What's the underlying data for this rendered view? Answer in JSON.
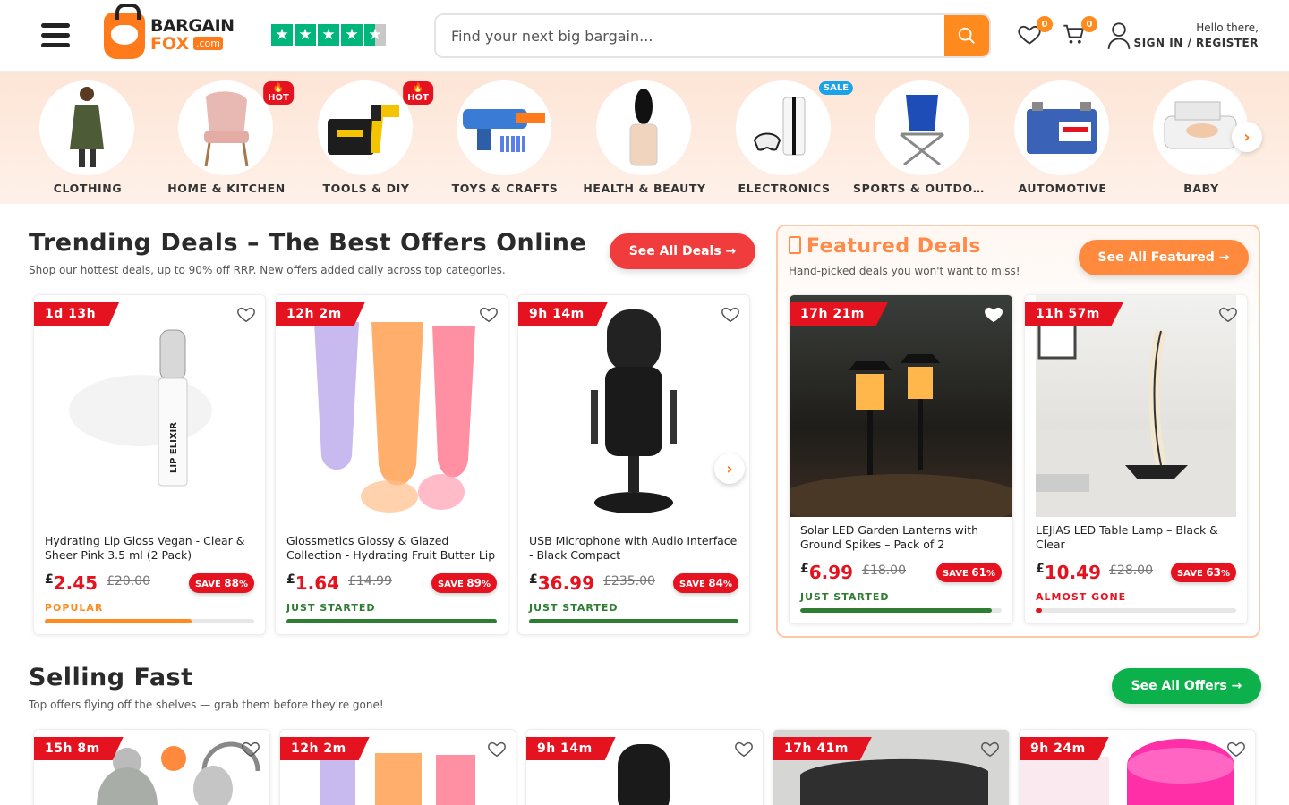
{
  "header": {
    "logo_line1": "BARGAIN",
    "logo_line2": "FOX",
    "logo_suffix": ".com",
    "search_placeholder": "Find your next big bargain...",
    "wishlist_count": "0",
    "cart_count": "0",
    "hello": "Hello there,",
    "sign_in": "SIGN IN / REGISTER"
  },
  "categories": [
    {
      "label": "CLOTHING",
      "tag": ""
    },
    {
      "label": "HOME & KITCHEN",
      "tag": "🔥HOT"
    },
    {
      "label": "TOOLS & DIY",
      "tag": "🔥HOT"
    },
    {
      "label": "TOYS & CRAFTS",
      "tag": ""
    },
    {
      "label": "HEALTH & BEAUTY",
      "tag": ""
    },
    {
      "label": "ELECTRONICS",
      "tag": "SALE"
    },
    {
      "label": "SPORTS & OUTDOORS",
      "tag": ""
    },
    {
      "label": "AUTOMOTIVE",
      "tag": ""
    },
    {
      "label": "BABY",
      "tag": ""
    }
  ],
  "trending": {
    "title": "Trending Deals – The Best Offers Online",
    "subtitle": "Shop our hottest deals, up to 90% off RRP. New offers added daily across top categories.",
    "button": "See All Deals →",
    "products": [
      {
        "timer": "1d 13h",
        "title": "Hydrating Lip Gloss Vegan - Clear & Sheer Pink 3.5 ml (2 Pack)",
        "currency": "£",
        "price": "2.45",
        "was": "£20.00",
        "save_label": "SAVE",
        "save": "88",
        "pct": "%",
        "status": "POPULAR",
        "progress": 0.7
      },
      {
        "timer": "12h 2m",
        "title": "Glossmetics Glossy & Glazed Collection - Hydrating Fruit Butter Lip Gloss",
        "currency": "£",
        "price": "1.64",
        "was": "£14.99",
        "save_label": "SAVE",
        "save": "89",
        "pct": "%",
        "status": "JUST STARTED",
        "progress": 1.0
      },
      {
        "timer": "9h 14m",
        "title": "USB Microphone with Audio Interface - Black Compact",
        "currency": "£",
        "price": "36.99",
        "was": "£235.00",
        "save_label": "SAVE",
        "save": "84",
        "pct": "%",
        "status": "JUST STARTED",
        "progress": 1.0
      }
    ]
  },
  "featured": {
    "title": "Featured Deals",
    "subtitle": "Hand-picked deals you won't want to miss!",
    "button": "See All Featured →",
    "products": [
      {
        "timer": "17h 21m",
        "title": "Solar LED Garden Lanterns with Ground Spikes – Pack of 2",
        "currency": "£",
        "price": "6.99",
        "was": "£18.00",
        "save_label": "SAVE",
        "save": "61",
        "pct": "%",
        "status": "JUST STARTED",
        "progress": 0.95
      },
      {
        "timer": "11h 57m",
        "title": "LEJIAS LED Table Lamp – Black & Clear",
        "currency": "£",
        "price": "10.49",
        "was": "£28.00",
        "save_label": "SAVE",
        "save": "63",
        "pct": "%",
        "status": "ALMOST GONE",
        "progress": 0.03
      }
    ]
  },
  "selling": {
    "title": "Selling Fast",
    "subtitle": "Top offers flying off the shelves — grab them before they're gone!",
    "button": "See All Offers →",
    "timers": [
      "15h 8m",
      "12h 2m",
      "9h 14m",
      "17h 41m",
      "9h 24m"
    ]
  },
  "colors": {
    "brand_orange": "#ff8a1e",
    "deal_red": "#e5121f",
    "offer_green": "#0db14b",
    "popular": "#ff8a1e",
    "just_started": "#2e7d32",
    "almost_gone": "#e5121f"
  }
}
